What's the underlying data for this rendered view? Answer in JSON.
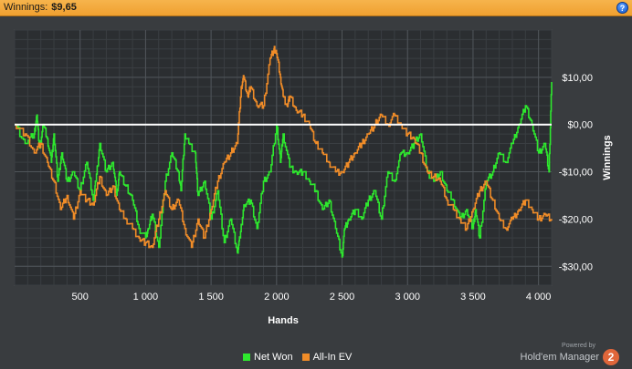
{
  "header": {
    "title": "Winnings:",
    "value": "$9,65",
    "help_label": "?"
  },
  "legend": {
    "items": [
      {
        "label": "Net Won",
        "color": "#2ee82e"
      },
      {
        "label": "All-In EV",
        "color": "#f08c28"
      }
    ]
  },
  "brand": {
    "powered": "Powered by",
    "name": "Hold'em Manager",
    "logo": "2"
  },
  "chart_data": {
    "type": "line",
    "xlabel": "Hands",
    "ylabel": "Winnings",
    "xlim": [
      0,
      4100
    ],
    "ylim": [
      -34,
      20
    ],
    "x_ticks": [
      500,
      1000,
      1500,
      2000,
      2500,
      3000,
      3500,
      4000
    ],
    "x_tick_labels": [
      "500",
      "1 000",
      "1 500",
      "2 000",
      "2 500",
      "3 000",
      "3 500",
      "4 000"
    ],
    "y_ticks": [
      10,
      0,
      -10,
      -20,
      -30
    ],
    "y_tick_labels": [
      "$10,00",
      "$0,00",
      "-$10,00",
      "-$20,00",
      "-$30,00"
    ],
    "zero_line": 0,
    "grid": true,
    "series": [
      {
        "name": "Net Won",
        "color": "#2ee82e",
        "x": [
          0,
          80,
          150,
          170,
          190,
          220,
          250,
          280,
          300,
          330,
          360,
          400,
          450,
          500,
          550,
          600,
          620,
          650,
          700,
          750,
          780,
          800,
          850,
          900,
          950,
          1000,
          1020,
          1050,
          1100,
          1150,
          1200,
          1250,
          1270,
          1300,
          1330,
          1380,
          1400,
          1450,
          1500,
          1550,
          1600,
          1650,
          1700,
          1720,
          1750,
          1800,
          1850,
          1900,
          1950,
          2000,
          2030,
          2050,
          2100,
          2150,
          2200,
          2250,
          2300,
          2350,
          2400,
          2450,
          2500,
          2520,
          2550,
          2600,
          2650,
          2700,
          2750,
          2800,
          2850,
          2900,
          2950,
          3000,
          3050,
          3100,
          3150,
          3200,
          3250,
          3300,
          3350,
          3400,
          3450,
          3500,
          3520,
          3550,
          3600,
          3650,
          3700,
          3750,
          3800,
          3850,
          3900,
          3950,
          4000,
          4050,
          4080,
          4100
        ],
        "y": [
          0,
          -4,
          -2,
          2,
          -5,
          0,
          -3,
          -8,
          -2,
          -12,
          -6,
          -12,
          -10,
          -14,
          -8,
          -16,
          -12,
          -4,
          -10,
          -8,
          -15,
          -10,
          -13,
          -16,
          -22,
          -24,
          -22,
          -19,
          -26,
          -12,
          -6,
          -10,
          -14,
          -2,
          -4,
          -6,
          -15,
          -12,
          -20,
          -14,
          -25,
          -20,
          -27,
          -24,
          -17,
          -16,
          -22,
          -12,
          -10,
          0,
          -8,
          -2,
          -9,
          -10,
          -10,
          -12,
          -14,
          -18,
          -16,
          -22,
          -28,
          -22,
          -20,
          -18,
          -20,
          -16,
          -14,
          -20,
          -10,
          -12,
          -6,
          -6,
          -4,
          -2,
          -10,
          -12,
          -10,
          -14,
          -16,
          -20,
          -18,
          -22,
          -18,
          -24,
          -12,
          -10,
          -6,
          -8,
          -4,
          0,
          4,
          0,
          -6,
          -4,
          -10,
          9
        ]
      },
      {
        "name": "All-In EV",
        "color": "#f08c28",
        "x": [
          0,
          80,
          150,
          200,
          250,
          300,
          350,
          400,
          450,
          500,
          550,
          600,
          650,
          700,
          750,
          800,
          850,
          900,
          950,
          1000,
          1050,
          1100,
          1150,
          1200,
          1250,
          1300,
          1350,
          1400,
          1450,
          1500,
          1550,
          1600,
          1650,
          1700,
          1730,
          1750,
          1780,
          1800,
          1850,
          1900,
          1950,
          1980,
          2000,
          2030,
          2050,
          2080,
          2100,
          2150,
          2200,
          2250,
          2300,
          2350,
          2400,
          2450,
          2500,
          2550,
          2600,
          2650,
          2700,
          2750,
          2800,
          2850,
          2900,
          2950,
          3000,
          3050,
          3100,
          3150,
          3200,
          3250,
          3300,
          3350,
          3400,
          3450,
          3500,
          3550,
          3600,
          3650,
          3700,
          3750,
          3800,
          3850,
          3900,
          3950,
          4000,
          4050,
          4100
        ],
        "y": [
          0,
          -2,
          -6,
          -4,
          -8,
          -12,
          -18,
          -15,
          -20,
          -14,
          -16,
          -17,
          -11,
          -15,
          -13,
          -18,
          -20,
          -22,
          -24,
          -25,
          -26,
          -20,
          -14,
          -18,
          -16,
          -22,
          -26,
          -20,
          -24,
          -18,
          -12,
          -8,
          -6,
          -4,
          8,
          10,
          6,
          8,
          4,
          4,
          14,
          16,
          15,
          10,
          6,
          4,
          6,
          3,
          2,
          0,
          -4,
          -6,
          -8,
          -10,
          -10,
          -8,
          -6,
          -4,
          -2,
          0,
          2,
          0,
          2,
          0,
          -2,
          -3,
          -6,
          -10,
          -11,
          -12,
          -16,
          -18,
          -20,
          -22,
          -18,
          -14,
          -12,
          -16,
          -20,
          -22,
          -20,
          -18,
          -16,
          -18,
          -20,
          -19,
          -20
        ]
      }
    ]
  }
}
